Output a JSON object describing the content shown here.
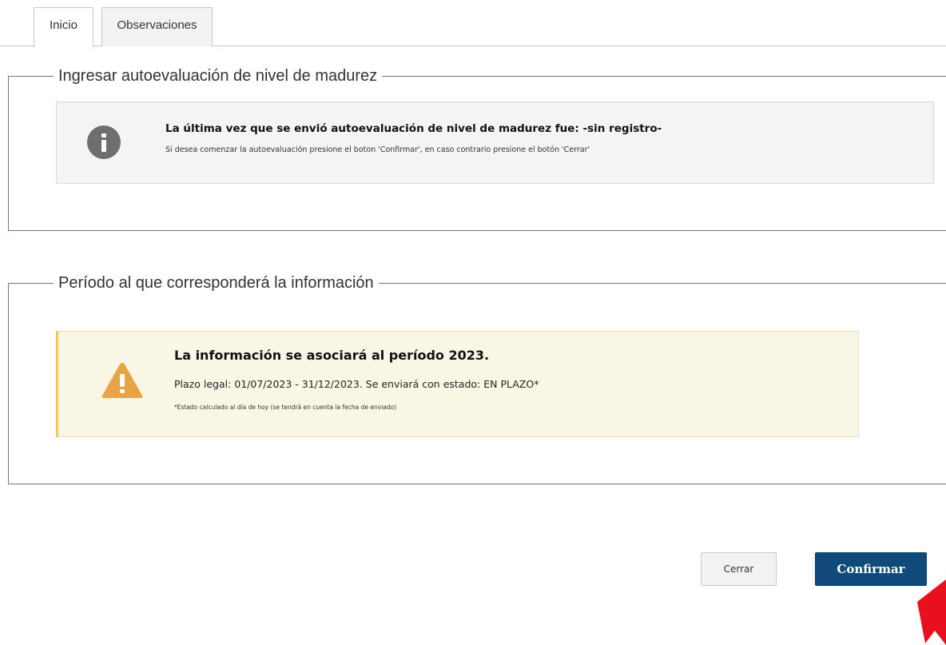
{
  "tabs": [
    {
      "label": "Inicio",
      "active": true
    },
    {
      "label": "Observaciones",
      "active": false
    }
  ],
  "section1": {
    "legend": "Ingresar autoevaluación de nivel de madurez",
    "info": {
      "icon": "info-icon",
      "title": "La última vez que se envió autoevaluación de nivel de madurez fue: -sin registro-",
      "subtitle": "Si desea comenzar la autoevaluación presione el boton 'Confirmar', en caso contrario presione el botón 'Cerrar'"
    }
  },
  "section2": {
    "legend": "Período al que corresponderá la información",
    "warning": {
      "icon": "warning-icon",
      "title": "La información se asociará al período 2023.",
      "line": "Plazo legal: 01/07/2023 - 31/12/2023. Se enviará con estado: EN PLAZO*",
      "note": "*Estado calculado al día de hoy (se tendrá en cuenta la fecha de enviado)"
    }
  },
  "buttons": {
    "cerrar": "Cerrar",
    "confirmar": "Confirmar"
  },
  "colors": {
    "confirm_bg": "#0f4a7a",
    "warning_icon": "#e6a545",
    "info_icon": "#6e6e6e",
    "pointer": "#e8101e"
  }
}
